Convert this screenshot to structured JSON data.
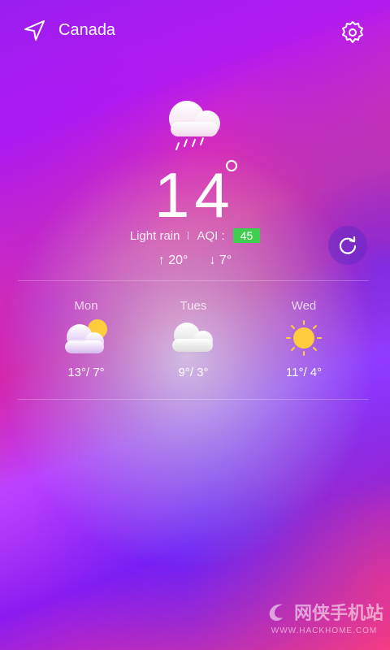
{
  "header": {
    "location": "Canada"
  },
  "current": {
    "temperature": "14",
    "condition": "Light rain",
    "aqi_label": "AQI :",
    "aqi_value": "45",
    "aqi_color": "#3ecf4e",
    "high": "↑ 20°",
    "low": "↓ 7°",
    "icon": "rain-cloud-icon"
  },
  "forecast": [
    {
      "day": "Mon",
      "temps": "13°/ 7°",
      "icon": "partly-cloudy-icon"
    },
    {
      "day": "Tues",
      "temps": "9°/ 3°",
      "icon": "cloud-icon"
    },
    {
      "day": "Wed",
      "temps": "11°/ 4°",
      "icon": "sun-icon"
    }
  ],
  "watermark": {
    "brand": "网侠手机站",
    "url": "WWW.HACKHOME.COM"
  }
}
